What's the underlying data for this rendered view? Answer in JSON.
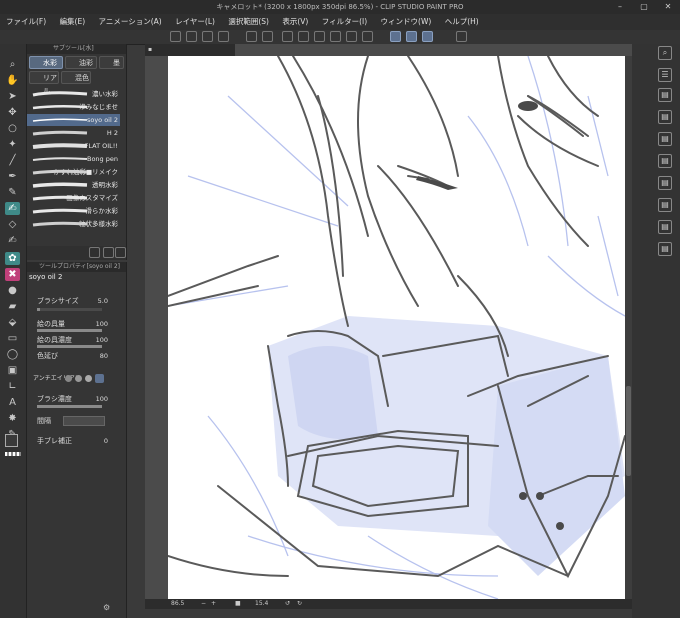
{
  "window": {
    "title": "キャメロット* (3200 x 1800px 350dpi 86.5%)  - CLIP STUDIO PAINT PRO",
    "minimize": "–",
    "maximize": "▢",
    "close": "✕"
  },
  "menu": [
    "ファイル(F)",
    "編集(E)",
    "アニメーション(A)",
    "レイヤー(L)",
    "選択範囲(S)",
    "表示(V)",
    "フィルター(I)",
    "ウィンドウ(W)",
    "ヘルプ(H)"
  ],
  "subtool": {
    "panel_title": "サブツール[水]",
    "tabs": [
      "水彩",
      "油彩",
      "墨",
      "リアル",
      "混色"
    ],
    "brushes": [
      "濃い水彩",
      "滲みなじませ",
      "soyo oil 2",
      "H 2",
      "FLAT OIL!!",
      "Bong pen",
      "かすれ油彩■リメイク",
      "透明水彩",
      "画像カスタマイズ",
      "滑らか水彩",
      "粒状多様水彩"
    ],
    "selected_index": 2
  },
  "properties": {
    "panel_title": "ツールプロパティ[soyo oil 2]",
    "tool_name": "soyo oil 2",
    "rows": [
      {
        "label": "ブラシサイズ",
        "value": "5.0"
      },
      {
        "label": "絵の具量",
        "value": "100"
      },
      {
        "label": "絵の具濃度",
        "value": "100"
      },
      {
        "label": "色延び",
        "value": "80"
      },
      {
        "label": "アンチエイリアス",
        "value": ""
      },
      {
        "label": "ブラシ濃度",
        "value": "100"
      },
      {
        "label": "間隔",
        "value": ""
      },
      {
        "label": "手ブレ補正",
        "value": "0"
      }
    ],
    "fills": {
      "brush_size": 0.05,
      "paint_amount": 1.0,
      "paint_density": 1.0,
      "color_stretch": 0.8,
      "brush_density": 1.0,
      "stabilization": 0.0
    }
  },
  "status": {
    "zoom": "86.5",
    "angle": "15.4"
  },
  "colors": {
    "accent": "#5d7190",
    "active_tool": "#3f8a88",
    "pink_tool": "#c0407a",
    "sketch_blue": "#b7c2ee",
    "line": "#555555"
  }
}
